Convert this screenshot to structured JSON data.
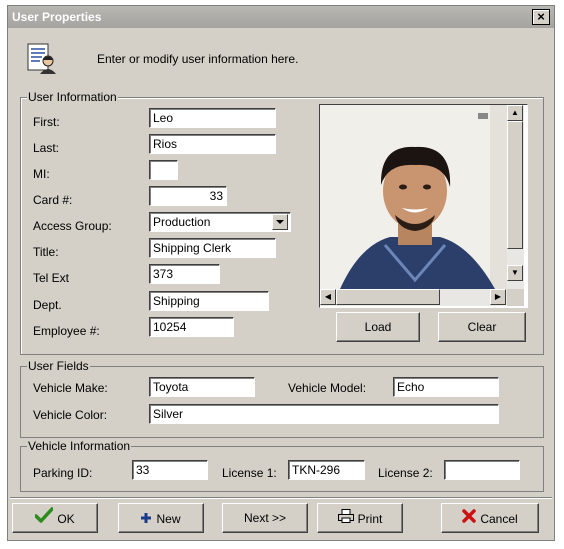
{
  "window": {
    "title": "User Properties",
    "close_glyph": "×"
  },
  "header": {
    "instruction": "Enter or modify user information here.",
    "icon": "user-document-icon"
  },
  "user_info": {
    "legend": "User Information",
    "first_label": "First:",
    "first_value": "Leo",
    "last_label": "Last:",
    "last_value": "Rios",
    "mi_label": "MI:",
    "mi_value": "",
    "card_label": "Card #:",
    "card_value": "33",
    "access_label": "Access Group:",
    "access_value": "Production",
    "title_label": "Title:",
    "title_value": "Shipping Clerk",
    "telext_label": "Tel Ext",
    "telext_value": "373",
    "dept_label": "Dept.",
    "dept_value": "Shipping",
    "employee_label": "Employee #:",
    "employee_value": "10254",
    "load_label": "Load",
    "clear_label": "Clear"
  },
  "user_fields": {
    "legend": "User Fields",
    "make_label": "Vehicle Make:",
    "make_value": "Toyota",
    "model_label": "Vehicle Model:",
    "model_value": "Echo",
    "color_label": "Vehicle Color:",
    "color_value": "Silver"
  },
  "vehicle_info": {
    "legend": "Vehicle Information",
    "parking_label": "Parking ID:",
    "parking_value": "33",
    "license1_label": "License 1:",
    "license1_value": "TKN-296",
    "license2_label": "License 2:",
    "license2_value": ""
  },
  "buttons": {
    "ok": "OK",
    "new": "New",
    "next": "Next >>",
    "print": "Print",
    "cancel": "Cancel"
  },
  "colors": {
    "ok_check": "#2e8b1e",
    "new_plus": "#1b3a8a",
    "cancel_x": "#cc1111",
    "titlebar": "#a9a7a2"
  }
}
